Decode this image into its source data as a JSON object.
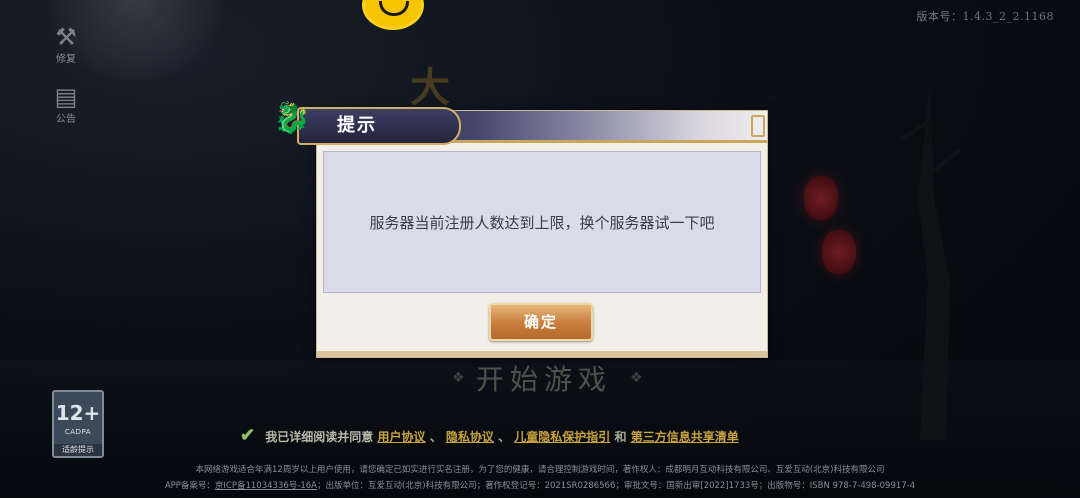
{
  "version_label": "版本号：1.4.3_2_2.1168",
  "side_buttons": [
    {
      "icon": "repair-icon",
      "label": "修复"
    },
    {
      "icon": "notice-board-icon",
      "label": "公告"
    }
  ],
  "dialog": {
    "title": "提示",
    "message": "服务器当前注册人数达到上限，换个服务器试一下吧",
    "confirm_label": "确定"
  },
  "start_label": "开始游戏",
  "age_badge": {
    "rating": "12+",
    "org": "CADPA",
    "tip": "适龄提示"
  },
  "agreement": {
    "prefix": "我已详细阅读并同意",
    "links": [
      "用户协议",
      "隐私协议",
      "儿童隐私保护指引",
      "第三方信息共享清单"
    ],
    "sep": "、",
    "and": "和"
  },
  "footer": {
    "line1": "本网络游戏适合年满12周岁以上用户使用，请您确定已如实进行实名注册，为了您的健康，请合理控制游戏时间，著作权人：成都明月互动科技有限公司、互爱互动(北京)科技有限公司",
    "line2_prefix": "APP备案号：",
    "line2_icp": "京ICP备11034336号-16A",
    "line2_rest": "；出版单位：互爱互动(北京)科技有限公司；著作权登记号：2021SR0286566；审批文号：国新出审[2022]1733号；出版物号：ISBN 978-7-498-09917-4"
  },
  "colors": {
    "accent_gold": "#c9a340",
    "confirm_button": "#c77d3d",
    "message_panel": "#dbdae9"
  }
}
